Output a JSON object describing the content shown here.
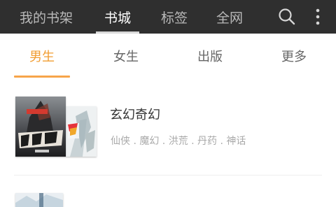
{
  "top_nav": {
    "tabs": [
      {
        "label": "我的书架"
      },
      {
        "label": "书城"
      },
      {
        "label": "标签"
      },
      {
        "label": "全网"
      }
    ],
    "active_index": 1,
    "icons": [
      "search-icon",
      "more-vert-icon"
    ]
  },
  "category_tabs": {
    "tabs": [
      {
        "label": "男生"
      },
      {
        "label": "女生"
      },
      {
        "label": "出版"
      },
      {
        "label": "更多"
      }
    ],
    "active_index": 0
  },
  "categories": [
    {
      "title": "玄幻奇幻",
      "tags": "仙侠 . 魔幻 . 洪荒 . 丹药 . 神话"
    }
  ],
  "colors": {
    "topbar_bg": "#2f2f2f",
    "accent": "#f19d32",
    "text_dark": "#333333",
    "text_muted": "#a9a9a9"
  }
}
